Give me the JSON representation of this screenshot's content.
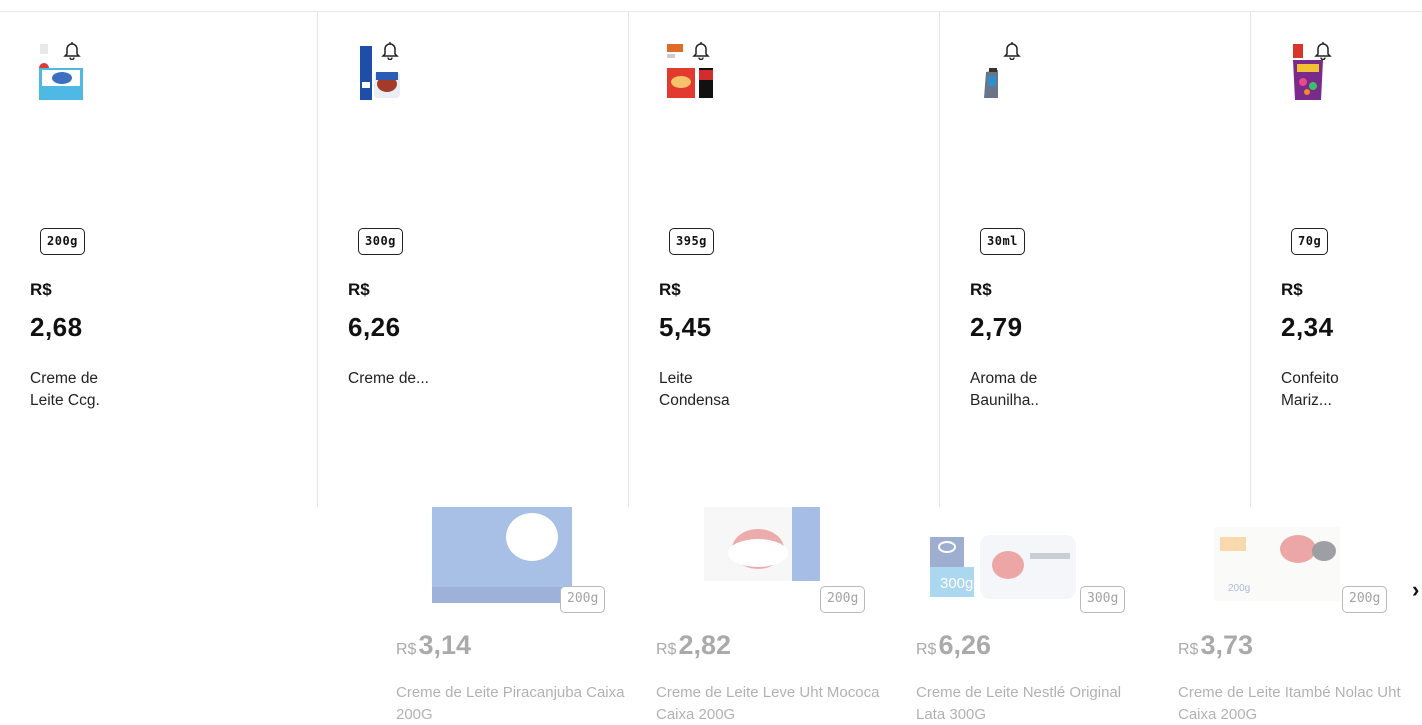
{
  "products": [
    {
      "size": "200g",
      "currency": "R$",
      "price": "2,68",
      "name": "Creme de Leite Ccg."
    },
    {
      "size": "300g",
      "currency": "R$",
      "price": "6,26",
      "name": "Creme de..."
    },
    {
      "size": "395g",
      "currency": "R$",
      "price": "5,45",
      "name": "Leite Condensa"
    },
    {
      "size": "30ml",
      "currency": "R$",
      "price": "2,79",
      "name": "Aroma de Baunilha.."
    },
    {
      "size": "70g",
      "currency": "R$",
      "price": "2,34",
      "name": "Confeito Mariz..."
    }
  ],
  "carousel": [
    {
      "size": "200g",
      "currency": "R$",
      "price": "3,14",
      "name": "Creme de Leite Piracanjuba Caixa 200G",
      "image_text": "200"
    },
    {
      "size": "200g",
      "currency": "R$",
      "price": "2,82",
      "name": "Creme de Leite Leve Uht Mococa Caixa 200G"
    },
    {
      "size": "300g",
      "currency": "R$",
      "price": "6,26",
      "name": "Creme de Leite Nestlé Original Lata 300G",
      "image_text": "300g"
    },
    {
      "size": "200g",
      "currency": "R$",
      "price": "3,73",
      "name": "Creme de Leite Itambé Nolac Uht Caixa 200G",
      "image_text": "200g"
    }
  ],
  "carousel_next_icon": "›",
  "icons": {
    "notify": "bell-icon",
    "next": "chevron-right-icon"
  }
}
